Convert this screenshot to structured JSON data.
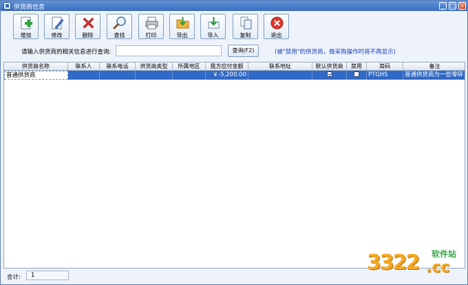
{
  "window": {
    "title": "供货商信息"
  },
  "toolbar": {
    "add": "增加",
    "edit": "修改",
    "delete": "删除",
    "find": "查找",
    "print": "打印",
    "export": "导出",
    "import": "导入",
    "copy": "复制",
    "exit": "退出"
  },
  "search": {
    "label": "请输入供货商的相关信息进行查询:",
    "value": "",
    "button": "查询(F2)",
    "hint": "(被\"禁用\"的供货商，做采购操作时将不再显示)"
  },
  "table": {
    "headers": [
      "供货商名称",
      "联系人",
      "联系电话",
      "供货商类型",
      "所属地区",
      "我方应付金额",
      "联系地址",
      "默认供货商",
      "禁用",
      "简码",
      "备注"
    ],
    "rows": [
      {
        "name": "普通供货商",
        "contact": "",
        "phone": "",
        "type": "",
        "region": "",
        "payable": "￥-5,200.00",
        "address": "",
        "default": true,
        "disabled": false,
        "code": "PTGHS",
        "note": "普通供货商为一些零碎"
      }
    ]
  },
  "footer": {
    "total_label": "合计:",
    "total_value": "1"
  },
  "watermark": {
    "number": "3322",
    "domain": ".cc",
    "text": "软件站"
  },
  "colors": {
    "selection": "#3169c6",
    "hint": "#1a3fb6",
    "watermark": "#f3a824"
  }
}
